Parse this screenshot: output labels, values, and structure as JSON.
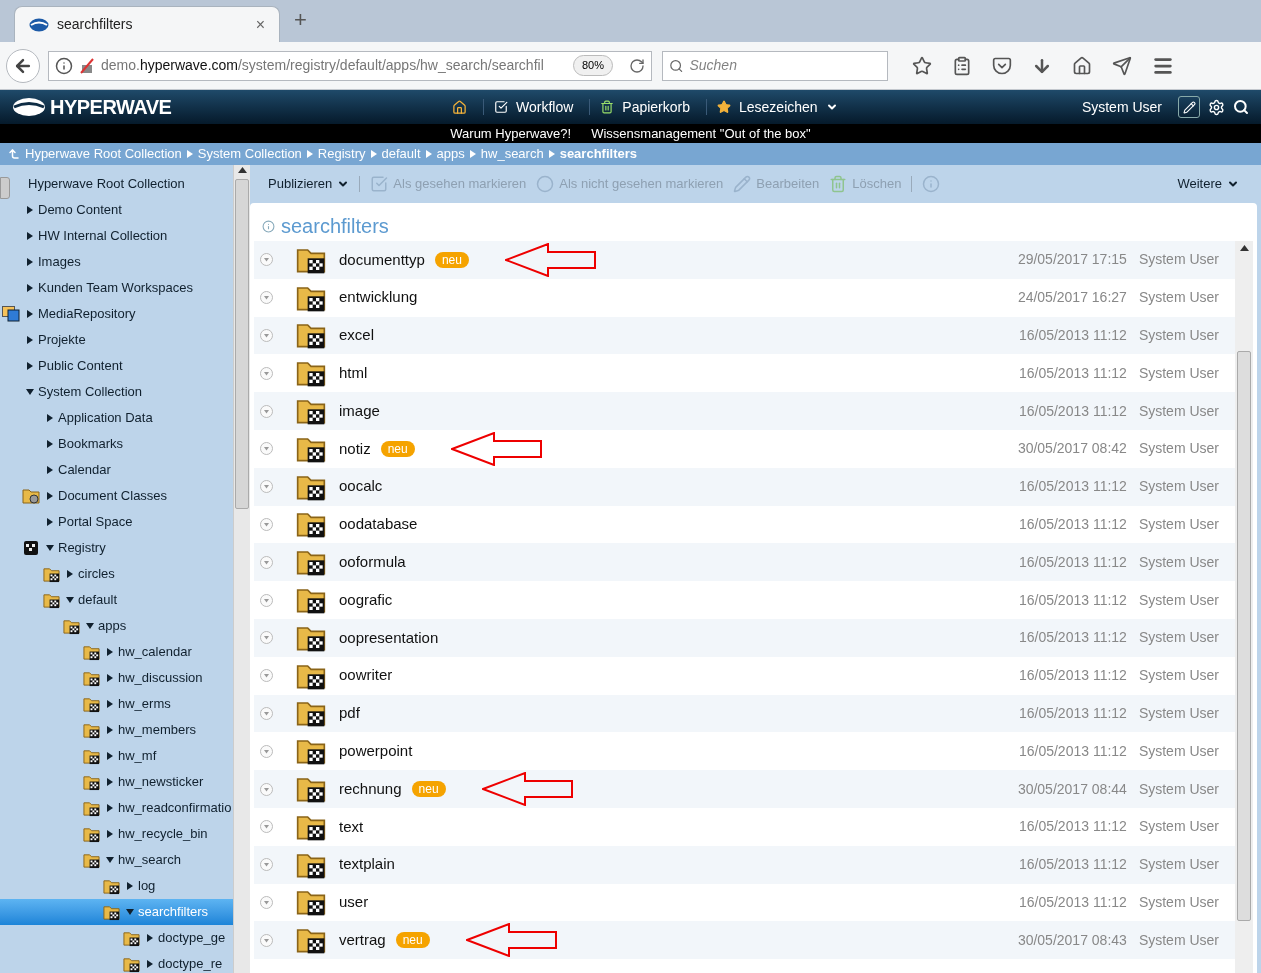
{
  "browser": {
    "tab": {
      "title": "searchfilters",
      "close": "×"
    },
    "new_tab": "+",
    "url": {
      "host_prefix": "demo.",
      "host": "hyperwave.com",
      "path": "/system/registry/default/apps/hw_search/searchfil"
    },
    "zoom": "80%",
    "search": {
      "placeholder": "Suchen"
    }
  },
  "header": {
    "logo": "HYPERWAVE",
    "nav": [
      {
        "kind": "home"
      },
      {
        "kind": "workflow",
        "label": "Workflow"
      },
      {
        "kind": "trash",
        "label": "Papierkorb"
      },
      {
        "kind": "bookmarks",
        "label": "Lesezeichen"
      }
    ],
    "user": "System User"
  },
  "links": [
    "Warum Hyperwave?!",
    "Wissensmanagement \"Out of the box\""
  ],
  "breadcrumb": [
    "Hyperwave Root Collection",
    "System Collection",
    "Registry",
    "default",
    "apps",
    "hw_search",
    "searchfilters"
  ],
  "sidebar": {
    "items": [
      {
        "label": "Hyperwave Root Collection",
        "selected": false,
        "children": [
          {
            "label": "Demo Content",
            "kind": "plain",
            "expanded": false,
            "selected": false
          },
          {
            "label": "HW Internal Collection",
            "kind": "plain",
            "expanded": false,
            "selected": false
          },
          {
            "label": "Images",
            "kind": "plain",
            "expanded": false,
            "selected": false
          },
          {
            "label": "Kunden Team Workspaces",
            "kind": "plain",
            "expanded": false,
            "selected": false
          },
          {
            "label": "MediaRepository",
            "kind": "media",
            "expanded": false,
            "selected": false
          },
          {
            "label": "Projekte",
            "kind": "plain",
            "expanded": false,
            "selected": false
          },
          {
            "label": "Public Content",
            "kind": "plain",
            "expanded": false,
            "selected": false
          },
          {
            "label": "System Collection",
            "kind": "plain",
            "expanded": true,
            "selected": false,
            "children": [
              {
                "label": "Application Data",
                "kind": "plain",
                "expanded": false,
                "selected": false
              },
              {
                "label": "Bookmarks",
                "kind": "plain",
                "expanded": false,
                "selected": false
              },
              {
                "label": "Calendar",
                "kind": "plain",
                "expanded": false,
                "selected": false
              },
              {
                "label": "Document Classes",
                "kind": "classes",
                "expanded": false,
                "selected": false
              },
              {
                "label": "Portal Space",
                "kind": "plain",
                "expanded": false,
                "selected": false
              },
              {
                "label": "Registry",
                "kind": "registry",
                "expanded": true,
                "selected": false,
                "children": [
                  {
                    "label": "circles",
                    "kind": "folder",
                    "expanded": false,
                    "selected": false
                  },
                  {
                    "label": "default",
                    "kind": "folder",
                    "expanded": true,
                    "selected": false,
                    "children": [
                      {
                        "label": "apps",
                        "kind": "folder",
                        "expanded": true,
                        "selected": false,
                        "children": [
                          {
                            "label": "hw_calendar",
                            "kind": "folder",
                            "expanded": false,
                            "selected": false
                          },
                          {
                            "label": "hw_discussion",
                            "kind": "folder",
                            "expanded": false,
                            "selected": false
                          },
                          {
                            "label": "hw_erms",
                            "kind": "folder",
                            "expanded": false,
                            "selected": false
                          },
                          {
                            "label": "hw_members",
                            "kind": "folder",
                            "expanded": false,
                            "selected": false
                          },
                          {
                            "label": "hw_mf",
                            "kind": "folder",
                            "expanded": false,
                            "selected": false
                          },
                          {
                            "label": "hw_newsticker",
                            "kind": "folder",
                            "expanded": false,
                            "selected": false
                          },
                          {
                            "label": "hw_readconfirmatio",
                            "kind": "folder",
                            "expanded": false,
                            "selected": false
                          },
                          {
                            "label": "hw_recycle_bin",
                            "kind": "folder",
                            "expanded": false,
                            "selected": false
                          },
                          {
                            "label": "hw_search",
                            "kind": "folder",
                            "expanded": true,
                            "selected": false,
                            "children": [
                              {
                                "label": "log",
                                "kind": "folder",
                                "expanded": false,
                                "selected": false
                              },
                              {
                                "label": "searchfilters",
                                "kind": "folder",
                                "expanded": true,
                                "selected": true,
                                "children": [
                                  {
                                    "label": "doctype_ge",
                                    "kind": "folder",
                                    "expanded": false,
                                    "selected": false
                                  },
                                  {
                                    "label": "doctype_re",
                                    "kind": "folder",
                                    "expanded": false,
                                    "selected": false
                                  }
                                ]
                              }
                            ]
                          }
                        ]
                      }
                    ]
                  }
                ]
              }
            ]
          }
        ]
      }
    ]
  },
  "toolbar": [
    {
      "kind": "menu",
      "label": "Publizieren",
      "disabled": false
    },
    {
      "kind": "check",
      "label": "Als gesehen markieren",
      "disabled": true
    },
    {
      "kind": "circle",
      "label": "Als nicht gesehen markieren",
      "disabled": true
    },
    {
      "kind": "edit",
      "label": "Bearbeiten",
      "disabled": true
    },
    {
      "kind": "delete",
      "label": "Löschen",
      "disabled": true
    },
    {
      "kind": "info",
      "disabled": true
    }
  ],
  "more": "Weitere",
  "panel": {
    "title": "searchfilters",
    "rows": [
      {
        "name": "documenttyp",
        "badge": "neu",
        "arrow": true,
        "date": "29/05/2017 17:15",
        "user": "System User"
      },
      {
        "name": "entwicklung",
        "arrow": false,
        "date": "24/05/2017 16:27",
        "user": "System User"
      },
      {
        "name": "excel",
        "arrow": false,
        "date": "16/05/2013 11:12",
        "user": "System User"
      },
      {
        "name": "html",
        "arrow": false,
        "date": "16/05/2013 11:12",
        "user": "System User"
      },
      {
        "name": "image",
        "arrow": false,
        "date": "16/05/2013 11:12",
        "user": "System User"
      },
      {
        "name": "notiz",
        "badge": "neu",
        "arrow": true,
        "date": "30/05/2017 08:42",
        "user": "System User"
      },
      {
        "name": "oocalc",
        "arrow": false,
        "date": "16/05/2013 11:12",
        "user": "System User"
      },
      {
        "name": "oodatabase",
        "arrow": false,
        "date": "16/05/2013 11:12",
        "user": "System User"
      },
      {
        "name": "ooformula",
        "arrow": false,
        "date": "16/05/2013 11:12",
        "user": "System User"
      },
      {
        "name": "oografic",
        "arrow": false,
        "date": "16/05/2013 11:12",
        "user": "System User"
      },
      {
        "name": "oopresentation",
        "arrow": false,
        "date": "16/05/2013 11:12",
        "user": "System User"
      },
      {
        "name": "oowriter",
        "arrow": false,
        "date": "16/05/2013 11:12",
        "user": "System User"
      },
      {
        "name": "pdf",
        "arrow": false,
        "date": "16/05/2013 11:12",
        "user": "System User"
      },
      {
        "name": "powerpoint",
        "arrow": false,
        "date": "16/05/2013 11:12",
        "user": "System User"
      },
      {
        "name": "rechnung",
        "badge": "neu",
        "arrow": true,
        "date": "30/05/2017 08:44",
        "user": "System User"
      },
      {
        "name": "text",
        "arrow": false,
        "date": "16/05/2013 11:12",
        "user": "System User"
      },
      {
        "name": "textplain",
        "arrow": false,
        "date": "16/05/2013 11:12",
        "user": "System User"
      },
      {
        "name": "user",
        "arrow": false,
        "date": "16/05/2013 11:12",
        "user": "System User"
      },
      {
        "name": "vertrag",
        "badge": "neu",
        "arrow": true,
        "date": "30/05/2017 08:43",
        "user": "System User"
      }
    ]
  }
}
